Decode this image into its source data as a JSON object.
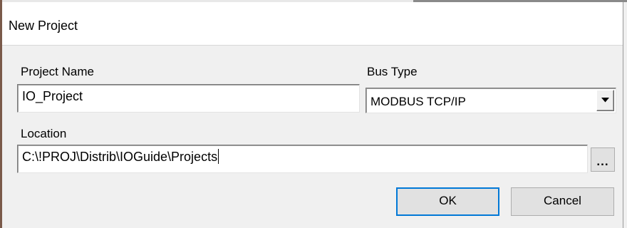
{
  "window": {
    "title": "New Project"
  },
  "form": {
    "project_name": {
      "label": "Project Name",
      "value": "IO_Project"
    },
    "bus_type": {
      "label": "Bus Type",
      "selected": "MODBUS TCP/IP",
      "arrow_icon": "chevron-down-icon"
    },
    "location": {
      "label": "Location",
      "value": "C:\\!PROJ\\Distrib\\IOGuide\\Projects",
      "browse_label": "..."
    }
  },
  "buttons": {
    "ok_label": "OK",
    "cancel_label": "Cancel"
  },
  "colors": {
    "dialog_bg": "#f0f0f0",
    "title_bg": "#ffffff",
    "default_button_border": "#0078d7"
  }
}
